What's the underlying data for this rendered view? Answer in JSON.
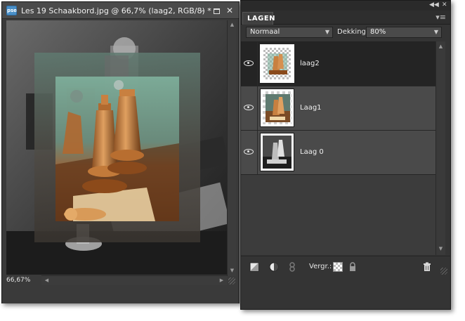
{
  "document": {
    "app_icon_text": "pse",
    "title": "Les 19 Schaakbord.jpg @ 66,7% (laag2, RGB/8) *",
    "zoom": "66,67%",
    "window_buttons": [
      "minimize-icon",
      "maximize-icon",
      "close-icon"
    ]
  },
  "layers_panel": {
    "tab_label": "LAGEN",
    "blend_mode": "Normaal",
    "opacity_label": "Dekking:",
    "opacity_value": "80%",
    "lock_label": "Vergr.:",
    "layers": [
      {
        "name": "laag2",
        "selected": true,
        "visible": true,
        "thumb": "chess-color-on-transparent"
      },
      {
        "name": "Laag1",
        "selected": false,
        "visible": true,
        "thumb": "chess-color"
      },
      {
        "name": "Laag 0",
        "selected": false,
        "visible": true,
        "thumb": "chess-grayscale"
      }
    ]
  },
  "colors": {
    "panel_bg": "#343434",
    "selected_row": "#242424",
    "row_bg": "#4a4a4a"
  }
}
